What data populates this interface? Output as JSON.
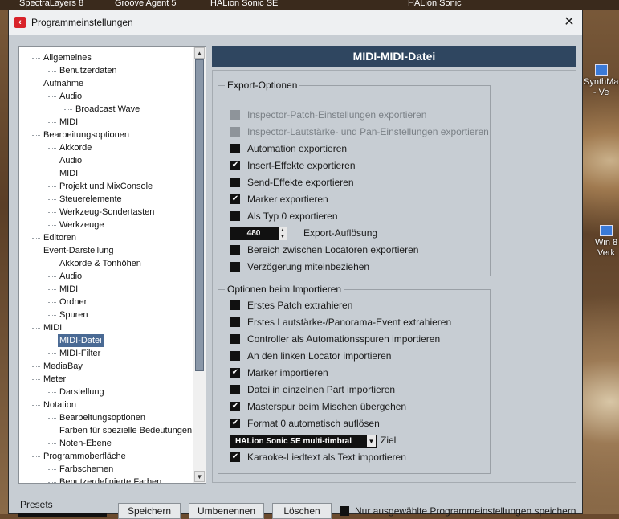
{
  "taskbar": [
    "SpectraLayers 8",
    "Groove Agent 5",
    "HALion Sonic SE",
    "HALion Sonic"
  ],
  "desktop_icons": [
    {
      "line1": "SynthMa",
      "line2": "- Ve"
    },
    {
      "line1": "Win 8",
      "line2": "Verk"
    }
  ],
  "window": {
    "title": "Programmeinstellungen",
    "close": "✕"
  },
  "tree": [
    {
      "label": "Allgemeines",
      "level": 0
    },
    {
      "label": "Benutzerdaten",
      "level": 1
    },
    {
      "label": "Aufnahme",
      "level": 0
    },
    {
      "label": "Audio",
      "level": 1
    },
    {
      "label": "Broadcast Wave",
      "level": 2
    },
    {
      "label": "MIDI",
      "level": 1
    },
    {
      "label": "Bearbeitungsoptionen",
      "level": 0
    },
    {
      "label": "Akkorde",
      "level": 1
    },
    {
      "label": "Audio",
      "level": 1
    },
    {
      "label": "MIDI",
      "level": 1
    },
    {
      "label": "Projekt und MixConsole",
      "level": 1
    },
    {
      "label": "Steuerelemente",
      "level": 1
    },
    {
      "label": "Werkzeug-Sondertasten",
      "level": 1
    },
    {
      "label": "Werkzeuge",
      "level": 1
    },
    {
      "label": "Editoren",
      "level": 0
    },
    {
      "label": "Event-Darstellung",
      "level": 0
    },
    {
      "label": "Akkorde & Tonhöhen",
      "level": 1
    },
    {
      "label": "Audio",
      "level": 1
    },
    {
      "label": "MIDI",
      "level": 1
    },
    {
      "label": "Ordner",
      "level": 1
    },
    {
      "label": "Spuren",
      "level": 1
    },
    {
      "label": "MIDI",
      "level": 0
    },
    {
      "label": "MIDI-Datei",
      "level": 1,
      "selected": true
    },
    {
      "label": "MIDI-Filter",
      "level": 1
    },
    {
      "label": "MediaBay",
      "level": 0
    },
    {
      "label": "Meter",
      "level": 0
    },
    {
      "label": "Darstellung",
      "level": 1
    },
    {
      "label": "Notation",
      "level": 0
    },
    {
      "label": "Bearbeitungsoptionen",
      "level": 1
    },
    {
      "label": "Farben für spezielle Bedeutungen",
      "level": 1
    },
    {
      "label": "Noten-Ebene",
      "level": 1
    },
    {
      "label": "Programmoberfläche",
      "level": 0
    },
    {
      "label": "Farbschemen",
      "level": 1
    },
    {
      "label": "Benutzerdefinierte Farben",
      "level": 1
    }
  ],
  "panel": {
    "header": "MIDI-MIDI-Datei",
    "export": {
      "title": "Export-Optionen",
      "options": [
        {
          "label": "Inspector-Patch-Einstellungen exportieren",
          "checked": false,
          "disabled": true
        },
        {
          "label": "Inspector-Lautstärke- und Pan-Einstellungen exportieren",
          "checked": false,
          "disabled": true
        },
        {
          "label": "Automation exportieren",
          "checked": false
        },
        {
          "label": "Insert-Effekte exportieren",
          "checked": true
        },
        {
          "label": "Send-Effekte exportieren",
          "checked": false
        },
        {
          "label": "Marker exportieren",
          "checked": true
        },
        {
          "label": "Als Typ 0 exportieren",
          "checked": false
        }
      ],
      "resolution_value": "480",
      "resolution_label": "Export-Auflösung",
      "options2": [
        {
          "label": "Bereich zwischen Locatoren exportieren",
          "checked": false
        },
        {
          "label": "Verzögerung miteinbeziehen",
          "checked": false
        }
      ]
    },
    "import": {
      "title": "Optionen beim Importieren",
      "options": [
        {
          "label": "Erstes Patch extrahieren",
          "checked": false
        },
        {
          "label": "Erstes Lautstärke-/Panorama-Event extrahieren",
          "checked": false
        },
        {
          "label": "Controller als Automationsspuren importieren",
          "checked": false
        },
        {
          "label": "An den linken Locator importieren",
          "checked": false
        },
        {
          "label": "Marker importieren",
          "checked": true
        },
        {
          "label": "Datei in einzelnen Part importieren",
          "checked": false
        },
        {
          "label": "Masterspur beim Mischen übergehen",
          "checked": true
        },
        {
          "label": "Format 0 automatisch auflösen",
          "checked": true
        }
      ],
      "target_value": "HALion Sonic SE multi-timbral",
      "target_label": "Ziel",
      "options2": [
        {
          "label": "Karaoke-Liedtext als Text importieren",
          "checked": true
        }
      ]
    }
  },
  "bottom": {
    "presets_label": "Presets",
    "save": "Speichern",
    "rename": "Umbenennen",
    "delete": "Löschen",
    "only_selected": "Nur ausgewählte Programmeinstellungen speichern",
    "only_selected_checked": false
  },
  "icons": {
    "check": "✔",
    "up": "▲",
    "down": "▼",
    "app": "app-logo-icon"
  }
}
